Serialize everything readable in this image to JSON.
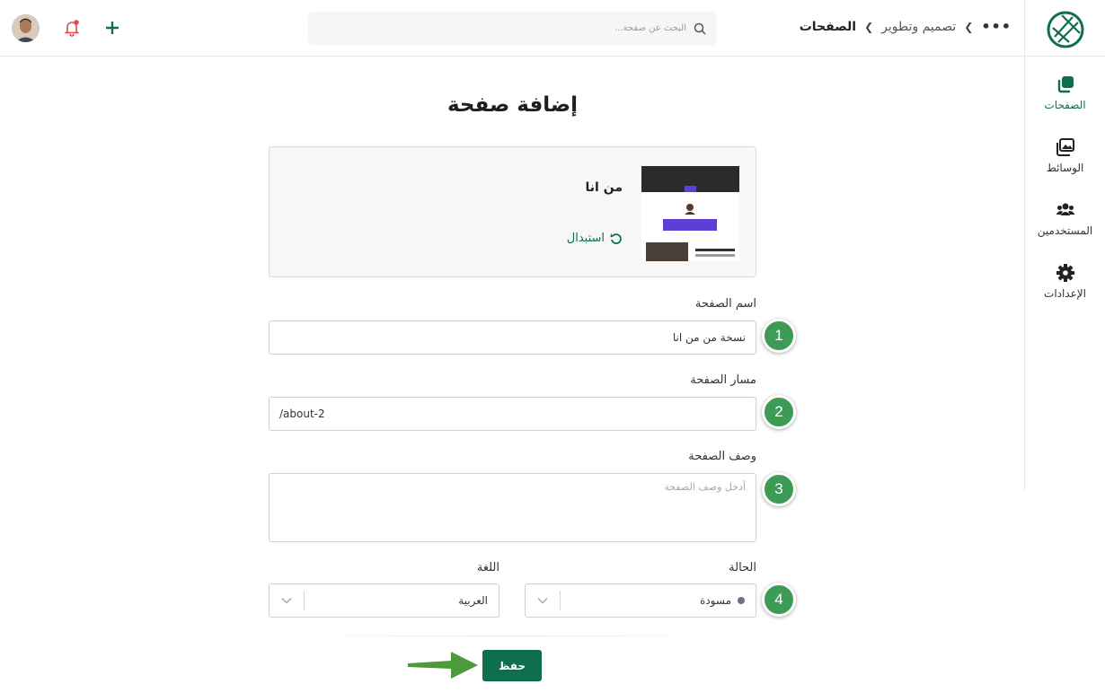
{
  "header": {
    "breadcrumb": [
      "تصميم وتطوير",
      "الصفحات"
    ],
    "more": "•••",
    "search_placeholder": "البحث عن صفحة..."
  },
  "sidebar": {
    "items": [
      {
        "label": "الصفحات",
        "icon": "pages-icon",
        "active": true
      },
      {
        "label": "الوسائط",
        "icon": "media-icon",
        "active": false
      },
      {
        "label": "المستخدمين",
        "icon": "users-icon",
        "active": false
      },
      {
        "label": "الإعدادات",
        "icon": "gear-icon",
        "active": false
      }
    ]
  },
  "page": {
    "title": "إضافة صفحة"
  },
  "template": {
    "name": "من انا",
    "replace_label": "استبدال"
  },
  "form": {
    "name_label": "اسم الصفحة",
    "name_value": "نسخة من من انا",
    "path_label": "مسار الصفحة",
    "path_value": "/about-2",
    "description_label": "وصف الصفحة",
    "description_placeholder": "أدخل وصف الصفحة",
    "status_label": "الحالة",
    "status_value": "مسودة",
    "language_label": "اللغة",
    "language_value": "العربية",
    "save_label": "حفظ"
  },
  "steps": [
    "1",
    "2",
    "3",
    "4"
  ],
  "colors": {
    "brand": "#0f6f4d",
    "step": "#3d9b55",
    "arrow": "#4d9a3a",
    "notification": "#e5484d"
  }
}
